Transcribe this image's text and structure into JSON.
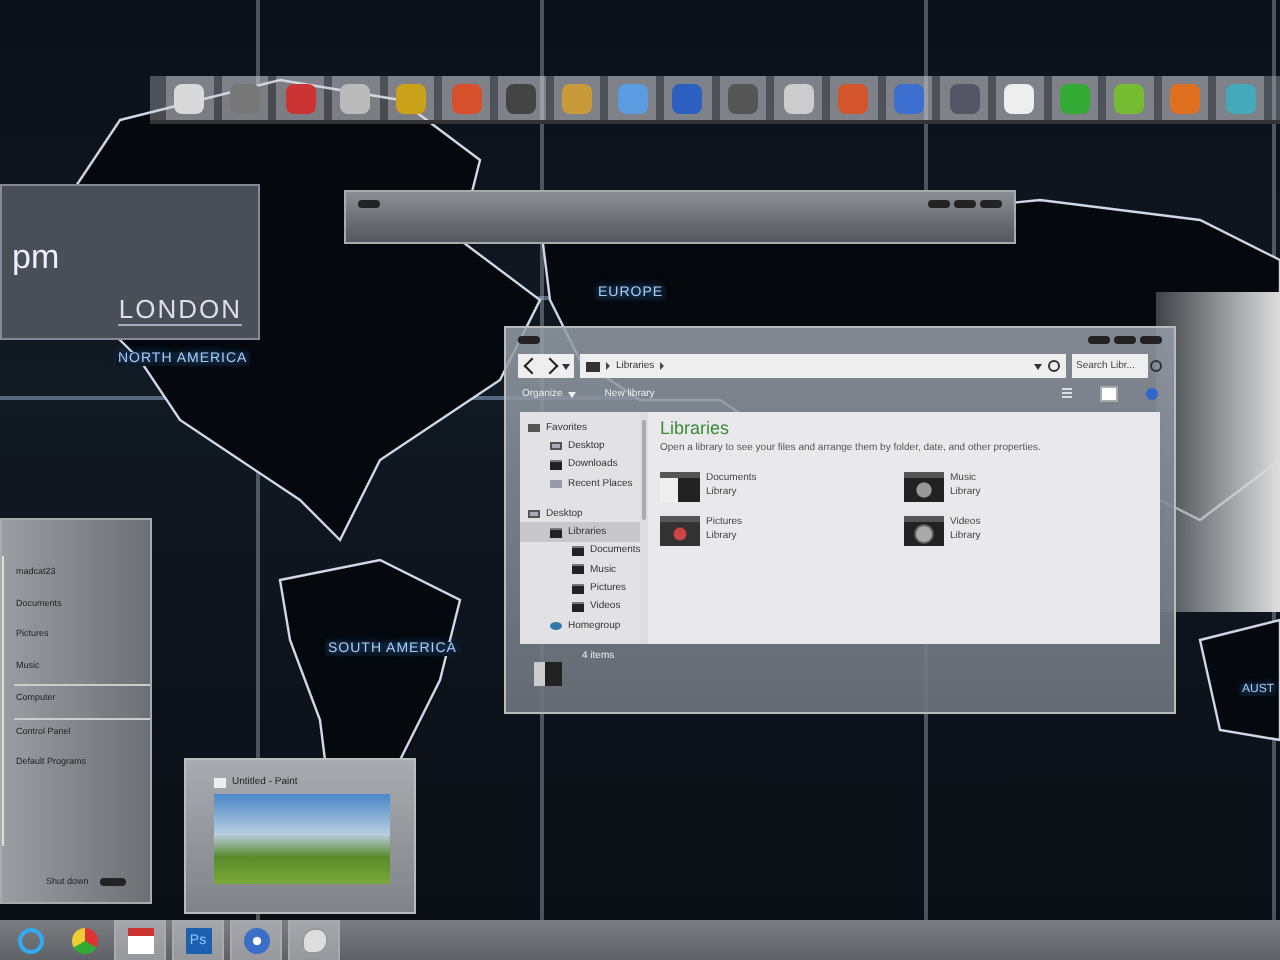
{
  "map_labels": [
    {
      "text": "NORTH AMERICA"
    },
    {
      "text": "EUROPE"
    },
    {
      "text": "SOUTH AMERICA"
    },
    {
      "text": "AUST"
    }
  ],
  "clock": {
    "time": "pm",
    "city": "LONDON"
  },
  "explorer": {
    "path": "Libraries",
    "search": {
      "placeholder": "Search Libr..."
    },
    "toolbar": [
      {
        "label": "Organize",
        "menu": true
      },
      {
        "label": "New library",
        "menu": false
      }
    ],
    "nav": [
      {
        "label": "Favorites",
        "kind": "star",
        "selected": false,
        "children": [
          {
            "label": "Desktop",
            "kind": "desktop",
            "selected": false
          },
          {
            "label": "Downloads",
            "kind": "folder",
            "selected": false
          },
          {
            "label": "Recent Places",
            "kind": "recent",
            "selected": false
          }
        ]
      },
      {
        "label": "Desktop",
        "kind": "desktop",
        "selected": false,
        "children": [
          {
            "label": "Libraries",
            "kind": "folder",
            "selected": true,
            "children": [
              {
                "label": "Documents",
                "kind": "folder",
                "selected": false
              },
              {
                "label": "Music",
                "kind": "folder",
                "selected": false
              },
              {
                "label": "Pictures",
                "kind": "folder",
                "selected": false
              },
              {
                "label": "Videos",
                "kind": "folder",
                "selected": false
              }
            ]
          },
          {
            "label": "Homegroup",
            "kind": "homegroup",
            "selected": false
          }
        ]
      }
    ],
    "title": "Libraries",
    "description": "Open a library to see your files and arrange them by folder, date, and other properties.",
    "libraries": [
      {
        "name": "Documents",
        "type": "Library",
        "kind": "documents"
      },
      {
        "name": "Music",
        "type": "Library",
        "kind": "music"
      },
      {
        "name": "Pictures",
        "type": "Library",
        "kind": "pictures"
      },
      {
        "name": "Videos",
        "type": "Library",
        "kind": "videos"
      }
    ],
    "status": "4 items"
  },
  "start_menu": {
    "groups": [
      [
        "madcat23",
        "Documents",
        "Pictures",
        "Music"
      ],
      [
        "Computer"
      ],
      [
        "Control Panel",
        "Default Programs"
      ]
    ],
    "shut_down": "Shut down"
  },
  "paint_preview": {
    "title": "Untitled - Paint"
  },
  "taskbar": [
    {
      "kind": "ie",
      "running": false
    },
    {
      "kind": "chrome",
      "running": false
    },
    {
      "kind": "calendar",
      "running": true
    },
    {
      "kind": "ps",
      "label": "Ps",
      "running": true
    },
    {
      "kind": "music",
      "running": true
    },
    {
      "kind": "paint",
      "running": true
    }
  ]
}
